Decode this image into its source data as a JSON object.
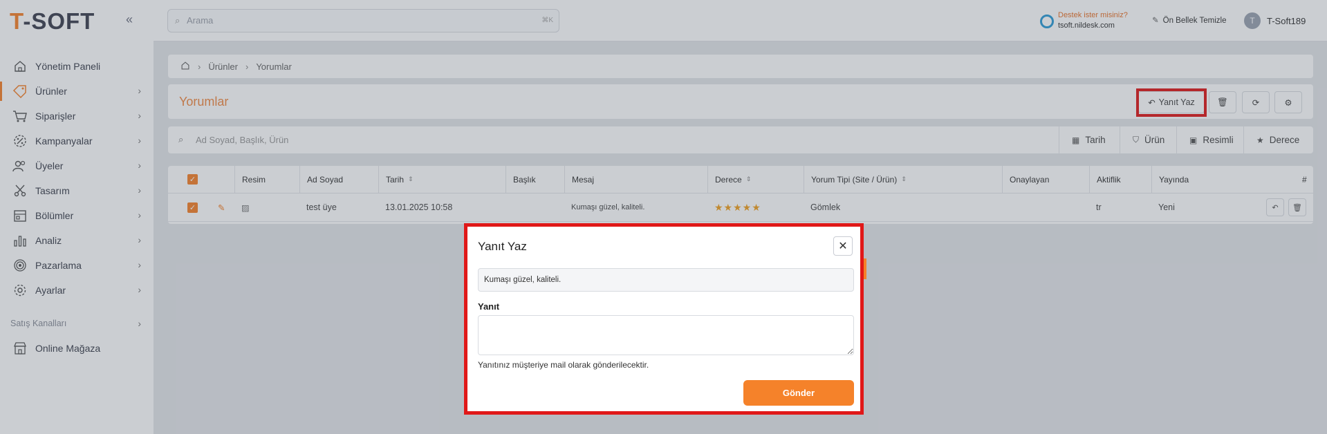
{
  "logo": {
    "text_t": "T",
    "text_rest": "-SOFT"
  },
  "search": {
    "placeholder": "Arama",
    "shortcut": "⌘K"
  },
  "help": {
    "line1": "Destek ister misiniz?",
    "line2": "tsoft.nildesk.com"
  },
  "cache": {
    "label": "Ön Bellek Temizle"
  },
  "user": {
    "initial": "T",
    "name": "T-Soft189"
  },
  "sidebar": {
    "items": [
      {
        "label": "Yönetim Paneli",
        "icon": "home-icon"
      },
      {
        "label": "Ürünler",
        "icon": "tag-icon"
      },
      {
        "label": "Siparişler",
        "icon": "cart-icon"
      },
      {
        "label": "Kampanyalar",
        "icon": "percent-icon"
      },
      {
        "label": "Üyeler",
        "icon": "users-icon"
      },
      {
        "label": "Tasarım",
        "icon": "scissors-icon"
      },
      {
        "label": "Bölümler",
        "icon": "layout-icon"
      },
      {
        "label": "Analiz",
        "icon": "chart-icon"
      },
      {
        "label": "Pazarlama",
        "icon": "target-icon"
      },
      {
        "label": "Ayarlar",
        "icon": "gear-icon"
      }
    ],
    "section": "Satış Kanalları",
    "store": {
      "label": "Online Mağaza",
      "icon": "store-icon"
    }
  },
  "breadcrumb": {
    "level1": "Ürünler",
    "level2": "Yorumlar"
  },
  "page": {
    "title": "Yorumlar",
    "reply_label": "Yanıt Yaz"
  },
  "filter": {
    "placeholder": "Ad Soyad, Başlık, Ürün",
    "buttons": [
      "Tarih",
      "Ürün",
      "Resimli",
      "Derece"
    ]
  },
  "table": {
    "headers": {
      "resim": "Resim",
      "ad_soyad": "Ad Soyad",
      "tarih": "Tarih",
      "baslik": "Başlık",
      "mesaj": "Mesaj",
      "derece": "Derece",
      "yorum_tipi": "Yorum Tipi (Site / Ürün)",
      "onaylayan": "Onaylayan",
      "aktiflik": "Aktiflik",
      "yayinda": "Yayında",
      "hash": "#"
    },
    "rows": [
      {
        "ad_soyad": "test üye",
        "tarih": "13.01.2025 10:58",
        "baslik": "",
        "mesaj": "Kumaşı güzel, kaliteli.",
        "derece": 5,
        "yorum_tipi": "Gömlek",
        "onaylayan": "",
        "aktiflik": "tr",
        "yayinda": "Yeni"
      }
    ]
  },
  "modal": {
    "title": "Yanıt Yaz",
    "message": "Kumaşı güzel, kaliteli.",
    "field_label": "Yanıt",
    "field_value": "",
    "hint": "Yanıtınız müşteriye mail olarak gönderilecektir.",
    "submit": "Gönder"
  },
  "colors": {
    "accent": "#f5822a",
    "highlight": "#e01818",
    "star": "#f0a020"
  }
}
